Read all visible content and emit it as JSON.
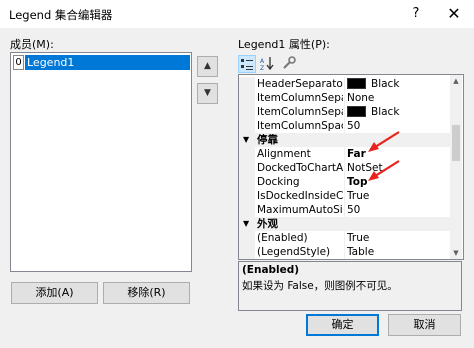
{
  "window": {
    "title": "Legend 集合编辑器",
    "help_label": "?",
    "close_label": "✕"
  },
  "members": {
    "label": "成员(M):",
    "items": [
      {
        "index": "0",
        "name": "Legend1"
      }
    ],
    "move_up_icon": "arrow-up-icon",
    "move_down_icon": "arrow-down-icon",
    "add_label": "添加(A)",
    "remove_label": "移除(R)"
  },
  "properties": {
    "label": "Legend1 属性(P):",
    "toolbar": {
      "categorized_icon": "categorized-icon",
      "alphabetical_icon": "alphabetical-icon",
      "property_pages_icon": "wrench-icon"
    },
    "rows": [
      {
        "name": "HeaderSeparatorColor",
        "value": "Black",
        "swatch": "#000000"
      },
      {
        "name": "ItemColumnSeparatorColor",
        "value": "None"
      },
      {
        "name": "ItemColumnSeparatorColor",
        "value": "Black",
        "swatch": "#000000"
      },
      {
        "name": "ItemColumnSpacing",
        "value": "50"
      }
    ],
    "category_docking": "停靠",
    "docking_rows": [
      {
        "name": "Alignment",
        "value": "Far",
        "bold": true
      },
      {
        "name": "DockedToChartArea",
        "value": "NotSet"
      },
      {
        "name": "Docking",
        "value": "Top",
        "bold": true
      },
      {
        "name": "IsDockedInsideChartArea",
        "value": "True"
      },
      {
        "name": "MaximumAutoSize",
        "value": "50"
      }
    ],
    "category_appearance": "外观",
    "appearance_rows": [
      {
        "name": "(Enabled)",
        "value": "True"
      },
      {
        "name": "(LegendStyle)",
        "value": "Table"
      }
    ],
    "description_title": "(Enabled)",
    "description_text": "如果设为 False，则图例不可见。"
  },
  "footer": {
    "ok_label": "确定",
    "cancel_label": "取消"
  },
  "colors": {
    "selection": "#0078d7",
    "annotation_arrow": "#e8231d"
  }
}
